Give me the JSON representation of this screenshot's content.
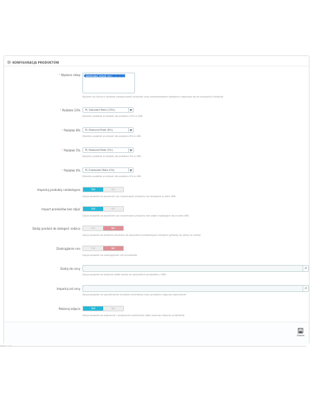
{
  "panel": {
    "title": "KONFIGURACJA PRODUKTÓW",
    "icon": "cog-icon"
  },
  "fields": {
    "stores": {
      "label": "Wybierz sklep",
      "required": "*",
      "options": [
        "adamsowa_import_cml"
      ],
      "help": "Wybierz do których sklepów zamportować produkty oraz przekierowanie kategorie importuję się do wszystkich sklepów"
    },
    "tax23": {
      "label": "Podatek 23%",
      "required": "*",
      "value": "PL Standard Rate (23%)",
      "help": "Wybierz podatek w sklepie dla podatku 23% w XML"
    },
    "tax8": {
      "label": "Podatek 8%",
      "required": "*",
      "value": "PL Reduced Rate (8%)",
      "help": "Wybierz podatek w sklepie dla podatku 8% w XML"
    },
    "tax5": {
      "label": "Podatek 5%",
      "required": "*",
      "value": "PL Reduced Rate (5%)",
      "help": "Wybierz podatek w sklepie dla podatku 5% w XML"
    },
    "tax0": {
      "label": "Podatek 0%",
      "required": "*",
      "value": "PL Exempted Rate (0%)",
      "help": "Wybierz podatek w sklepie dla podatku 0% w XML"
    },
    "import_unavailable": {
      "label": "Importuj produkty niedostępne",
      "yes": "TAK",
      "no": "NIE",
      "selected": "TAK",
      "help": "Opcja pozwala na wybranie czy importować produkty nie dostępne w pliku XML"
    },
    "import_no_images": {
      "label": "Import produktów bez zdjęć",
      "yes": "TAK",
      "no": "NIE",
      "selected": "TAK",
      "help": "Opcja pozwala na wybranie czy importować produkty bez zdjęć znajdujące się w pliku XML"
    },
    "add_to_root": {
      "label": "Dodaj produkt do kategorii rodzica",
      "yes": "TAK",
      "no": "NIE",
      "selected": "NIE",
      "help": "Opcja pozwala na dodanie produktu do wszystkich podkategorii kategorii głównej do jakiej on należy"
    },
    "round_prices": {
      "label": "Zaokrąglanie cen",
      "yes": "TAK",
      "no": "NIE",
      "selected": "NIE",
      "help": "Opcja pozwala na zaokrąglanie cen produktów"
    },
    "add_to_price": {
      "label": "Dodaj do ceny",
      "value": "",
      "suffix": "zł",
      "help": "Opcja pozwala na dodanie stałej kwoty do wszystkich produktów z XML"
    },
    "min_price": {
      "label": "Importuj od ceny",
      "value": "",
      "suffix": "zł",
      "help": "Opcja pozwala na ograniczenie od jakiej minimalnej ceny produkty mają się importować"
    },
    "fetch_images": {
      "label": "Pobieraj zdjęcia",
      "yes": "TAK",
      "no": "NIE",
      "selected": "TAK",
      "help": "Opcja pozwala na włączenie / wyłączenie pobierania zdjęć podczas importu produktów"
    }
  },
  "footer": {
    "save_label": "Zapisz",
    "save_icon": "save-icon"
  },
  "status_bar": "adane.com..."
}
